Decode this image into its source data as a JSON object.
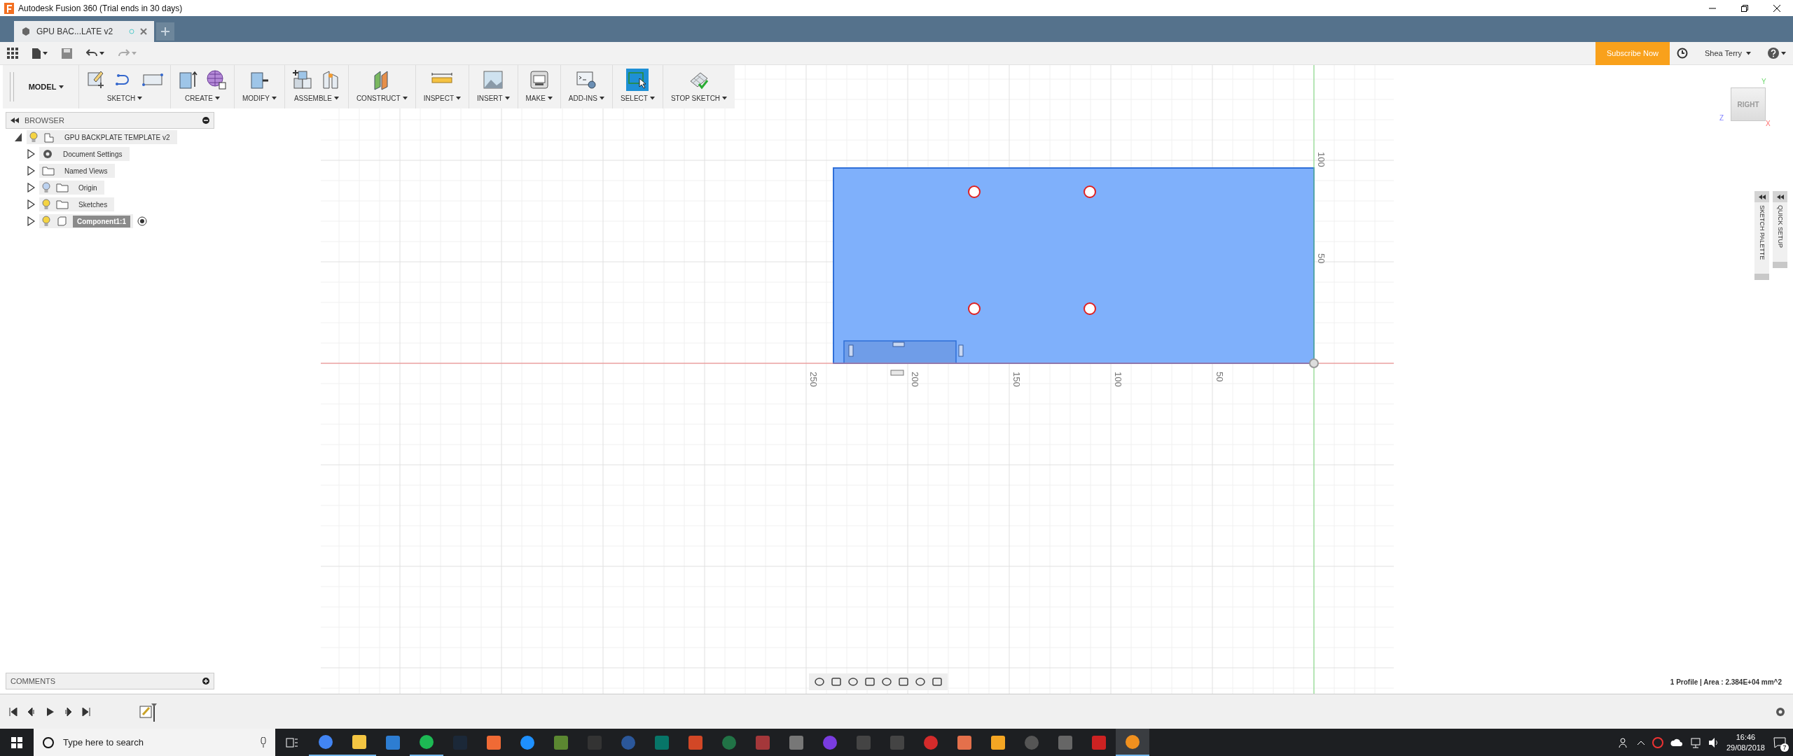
{
  "window": {
    "title": "Autodesk Fusion 360 (Trial ends in 30 days)"
  },
  "document_tabs": [
    {
      "label": "GPU BAC...LATE v2",
      "selected": true
    }
  ],
  "header": {
    "subscribe": "Subscribe Now",
    "user": "Shea Terry"
  },
  "toolbar": {
    "workspace": "MODEL",
    "groups": [
      {
        "label": "SKETCH",
        "active": false
      },
      {
        "label": "CREATE",
        "active": false
      },
      {
        "label": "MODIFY",
        "active": false
      },
      {
        "label": "ASSEMBLE",
        "active": false
      },
      {
        "label": "CONSTRUCT",
        "active": false
      },
      {
        "label": "INSPECT",
        "active": false
      },
      {
        "label": "INSERT",
        "active": false
      },
      {
        "label": "MAKE",
        "active": false
      },
      {
        "label": "ADD-INS",
        "active": false
      },
      {
        "label": "SELECT",
        "active": true
      },
      {
        "label": "STOP SKETCH",
        "active": false
      }
    ]
  },
  "browser": {
    "title": "BROWSER",
    "tree": [
      {
        "label": "GPU BACKPLATE TEMPLATE v2",
        "kind": "document",
        "visible": true,
        "expanded": true,
        "selected": false,
        "active": false,
        "children": [
          {
            "label": "Document Settings",
            "kind": "settings",
            "expanded": false,
            "selected": false,
            "active": false
          },
          {
            "label": "Named Views",
            "kind": "folder",
            "expanded": false,
            "selected": false,
            "active": false
          },
          {
            "label": "Origin",
            "kind": "folder",
            "visible": false,
            "expanded": false,
            "selected": false,
            "active": false
          },
          {
            "label": "Sketches",
            "kind": "folder",
            "visible": true,
            "expanded": false,
            "selected": false,
            "active": false
          },
          {
            "label": "Component1:1",
            "kind": "component",
            "visible": true,
            "expanded": false,
            "selected": true,
            "active": true
          }
        ]
      }
    ]
  },
  "view_cube": {
    "face": "RIGHT",
    "axes": {
      "y": "Y",
      "z": "Z",
      "x": "X"
    }
  },
  "side_panels": [
    {
      "label": "SKETCH PALETTE"
    },
    {
      "label": "QUICK SETUP"
    }
  ],
  "canvas": {
    "x_labels": [
      "250",
      "200",
      "150",
      "100",
      "50"
    ],
    "y_labels": [
      "100",
      "50"
    ]
  },
  "comments": {
    "title": "COMMENTS"
  },
  "status": "1 Profile | Area : 2.384E+04 mm^2",
  "taskbar": {
    "search_placeholder": "Type here to search",
    "time": "16:46",
    "date": "29/08/2018",
    "notifications": "7"
  }
}
